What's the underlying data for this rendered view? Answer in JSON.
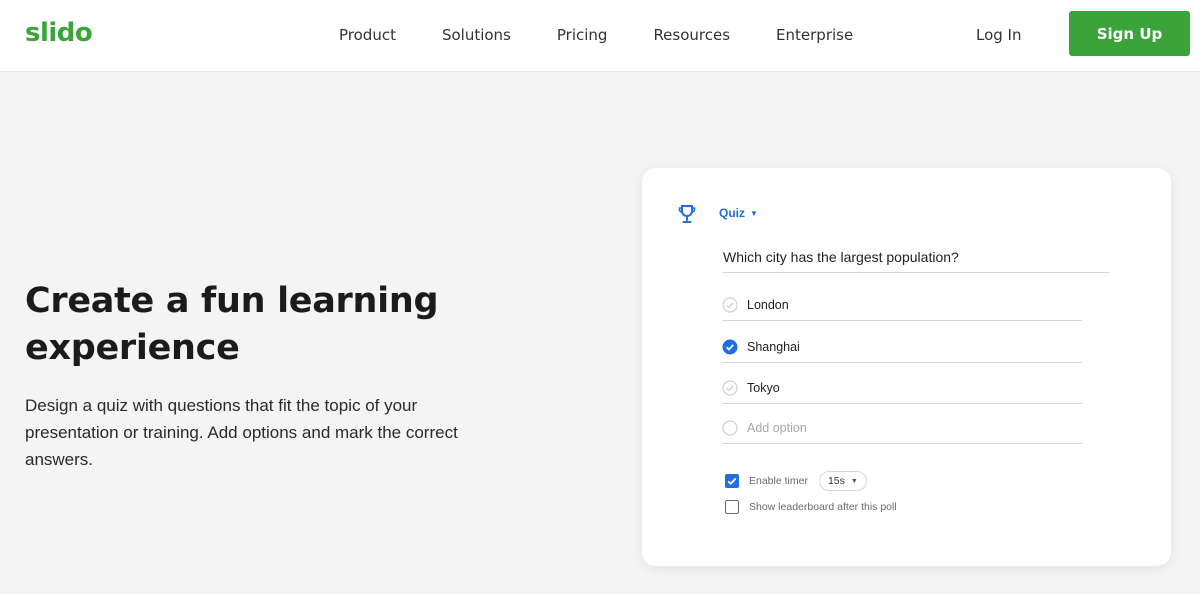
{
  "header": {
    "logo": "slido",
    "nav": [
      "Product",
      "Solutions",
      "Pricing",
      "Resources",
      "Enterprise"
    ],
    "login_label": "Log In",
    "signup_label": "Sign Up"
  },
  "hero": {
    "title": "Create a fun learning experience",
    "description": "Design a quiz with questions that fit the topic of your presentation or training. Add options and mark the correct answers."
  },
  "quiz_card": {
    "type_label": "Quiz",
    "question": "Which city has the largest population?",
    "options": [
      {
        "label": "London",
        "correct": false
      },
      {
        "label": "Shanghai",
        "correct": true
      },
      {
        "label": "Tokyo",
        "correct": false
      }
    ],
    "add_option_placeholder": "Add option",
    "settings": {
      "enable_timer_label": "Enable timer",
      "enable_timer_checked": true,
      "timer_value": "15s",
      "leaderboard_label": "Show leaderboard after this poll",
      "leaderboard_checked": false
    }
  },
  "colors": {
    "brand_green": "#3aa33a",
    "accent_blue": "#1f6fe0",
    "background": "#f4f4f4"
  },
  "icons": [
    "trophy-icon",
    "chevron-down-icon",
    "check-circle-icon",
    "checkbox-icon"
  ]
}
